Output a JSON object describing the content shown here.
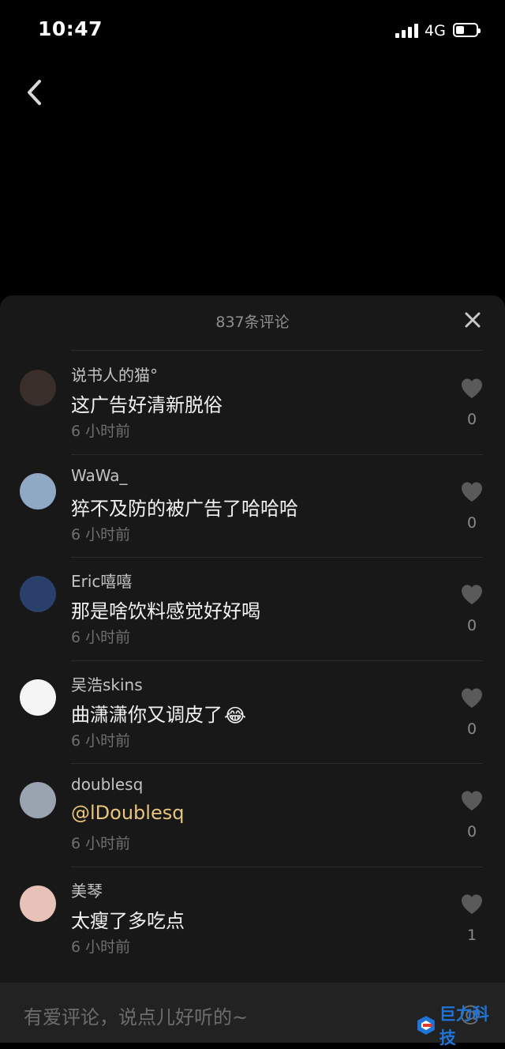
{
  "status_bar": {
    "time": "10:47",
    "network": "4G",
    "battery_percent": 40
  },
  "header": {
    "back_icon": "chevron-left-icon"
  },
  "comments_panel": {
    "count_label": "837条评论",
    "close_icon": "close-icon",
    "comments": [
      {
        "username": "说书人的猫°",
        "text": "这广告好清新脱俗",
        "time": "6 小时前",
        "likes": "0",
        "avatar_color": "#3a2e2a"
      },
      {
        "username": "WaWa_",
        "text": "猝不及防的被广告了哈哈哈",
        "time": "6 小时前",
        "likes": "0",
        "avatar_color": "#8fa8c4"
      },
      {
        "username": "Eric嘻嘻",
        "text": "那是啥饮料感觉好好喝",
        "time": "6 小时前",
        "likes": "0",
        "avatar_color": "#2a3f6a"
      },
      {
        "username": "吴浩skins",
        "text": "曲潇潇你又调皮了",
        "text_emoji": "😂",
        "time": "6 小时前",
        "likes": "0",
        "avatar_color": "#f5f5f5"
      },
      {
        "username": "doublesq",
        "text": "@lDoublesq",
        "time": "6 小时前",
        "likes": "0",
        "avatar_color": "#9aa3b0"
      },
      {
        "username": "美琴",
        "text": "太瘦了多吃点",
        "time": "6 小时前",
        "likes": "1",
        "avatar_color": "#e8c2b8"
      }
    ]
  },
  "input_bar": {
    "placeholder": "有爱评论，说点儿好听的~",
    "mention_symbol": "@"
  },
  "watermark": {
    "text": "巨力科技"
  },
  "colors": {
    "sheet_bg": "#181818",
    "mention": "#e8c57a",
    "like_icon": "#5a5a5a",
    "watermark": "#1f74d8"
  }
}
